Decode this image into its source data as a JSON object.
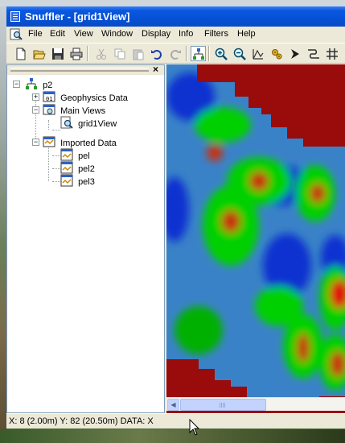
{
  "window": {
    "title": "Snuffler - [grid1View]"
  },
  "menubar": {
    "items": [
      "File",
      "Edit",
      "View",
      "Window",
      "Display",
      "Info",
      "Filters",
      "Help"
    ]
  },
  "toolbar": {
    "buttons": [
      "new-icon",
      "open-icon",
      "save-icon",
      "print-icon",
      "cut-icon",
      "copy-icon",
      "paste-icon",
      "undo-icon",
      "redo-icon",
      "tree-icon",
      "zoom-in-icon",
      "zoom-out-icon",
      "triangle-icon",
      "settings-icon",
      "arrow-icon",
      "link-icon",
      "grid-icon"
    ]
  },
  "tree": {
    "close_label": "×",
    "root": "p2",
    "nodes": {
      "geophysics": "Geophysics Data",
      "main_views": "Main Views",
      "grid1view": "grid1View",
      "imported": "Imported Data",
      "pel": "pel",
      "pel2": "pel2",
      "pel3": "pel3"
    }
  },
  "statusbar": {
    "text": "X:  8 (2.00m)  Y: 82 (20.50m)  DATA: X"
  },
  "colors": {
    "title_bar": "#0550d6",
    "grid_high": "#9a0b0b",
    "grid_mid": "#00e600",
    "grid_low": "#0a2cd6",
    "grid_base": "#3a82c8"
  }
}
